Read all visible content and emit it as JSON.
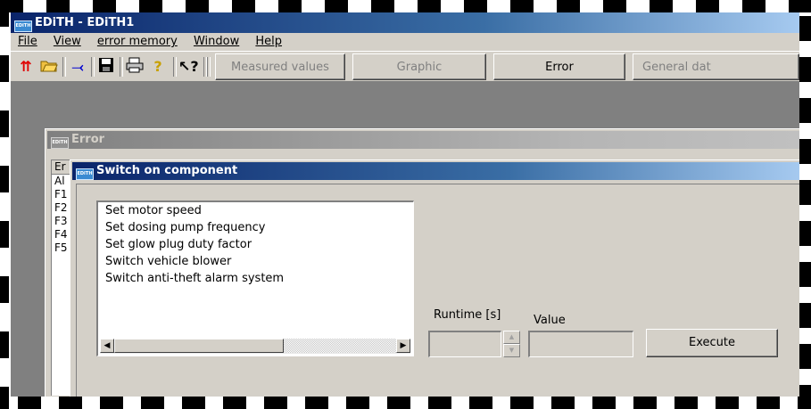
{
  "app": {
    "logo_text": "EDITH",
    "title": "EDiTH - EDiTH1"
  },
  "menu": [
    "File",
    "View",
    "error memory",
    "Window",
    "Help"
  ],
  "toolbar": {
    "icons": [
      "up-arrows-icon",
      "open-folder-icon",
      "connect-icon",
      "save-icon",
      "print-icon",
      "help-icon",
      "context-help-icon"
    ],
    "tabs": [
      "Measured values",
      "Graphic",
      "Error",
      "General dat"
    ],
    "active_tab": "Error"
  },
  "error_window": {
    "title": "Error",
    "list_items": [
      "Er",
      "Al",
      "F1",
      "F2",
      "F3",
      "F4",
      "F5"
    ]
  },
  "switch_window": {
    "title": "Switch on component",
    "components": [
      "Set motor speed",
      "Set dosing pump frequency",
      "Set glow plug duty factor",
      "Switch vehicle blower",
      "Switch anti-theft alarm system"
    ],
    "runtime_label": "Runtime [s]",
    "value_label": "Value",
    "runtime_value": "",
    "value_value": "",
    "execute_label": "Execute"
  }
}
